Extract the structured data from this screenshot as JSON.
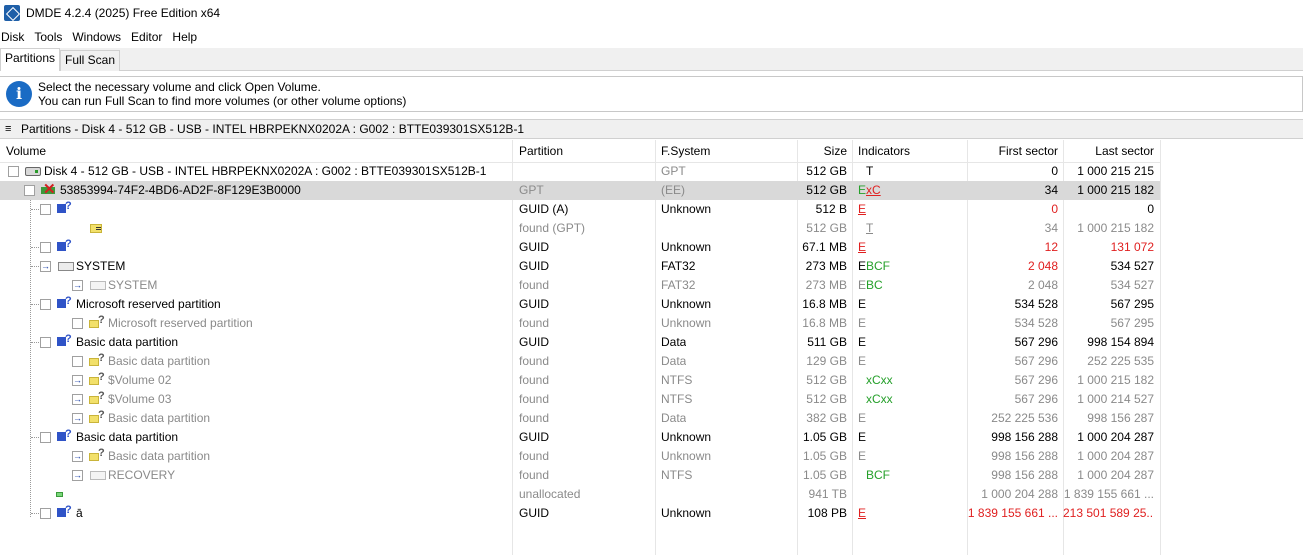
{
  "window": {
    "title": "DMDE 4.2.4 (2025) Free Edition x64",
    "icon": "dmde-app-icon"
  },
  "menu": [
    "Disk",
    "Tools",
    "Windows",
    "Editor",
    "Help"
  ],
  "tabs": [
    {
      "label": "Partitions",
      "active": true
    },
    {
      "label": "Full Scan",
      "active": false
    }
  ],
  "info": {
    "icon": "info-icon",
    "line1": "Select the necessary volume and click Open Volume.",
    "line2": "You can run Full Scan to find more volumes (or other volume options)"
  },
  "panel": {
    "title": "Partitions - Disk 4 - 512 GB - USB - INTEL HBRPEKNX0202A : G002 : BTTE039301SX512B-1"
  },
  "columns": {
    "volume": "Volume",
    "partition": "Partition",
    "fsystem": "F.System",
    "size": "Size",
    "indicators": "Indicators",
    "first_sector": "First sector",
    "last_sector": "Last sector"
  },
  "rows": [
    {
      "volume": "Disk 4 - 512 GB - USB - INTEL HBRPEKNX0202A : G002 : BTTE039301SX512B-1",
      "partition": "",
      "fs": "GPT",
      "size": "512 GB",
      "ind": "T",
      "first": "0",
      "last": "1 000 215 215"
    },
    {
      "volume": "53853994-74F2-4BD6-AD2F-8F129E3B0000",
      "partition": "GPT",
      "fs": "(EE)",
      "size": "512 GB",
      "ind_e": "E",
      "ind_x": "x",
      "ind_c": "C",
      "first": "34",
      "last": "1 000 215 182"
    },
    {
      "volume": "?",
      "partition": "GUID (A)",
      "fs": "Unknown",
      "size": "512 B",
      "ind": "E",
      "first": "0",
      "last": "0"
    },
    {
      "volume": "",
      "partition": "found (GPT)",
      "fs": "",
      "size": "512 GB",
      "ind": "T",
      "first": "34",
      "last": "1 000 215 182"
    },
    {
      "volume": "?",
      "partition": "GUID",
      "fs": "Unknown",
      "size": "67.1 MB",
      "ind": "E",
      "first": "12",
      "last": "131 072"
    },
    {
      "volume": "SYSTEM",
      "partition": "GUID",
      "fs": "FAT32",
      "size": "273 MB",
      "ind_e": "E",
      "ind_rest": "BCF",
      "first": "2 048",
      "last": "534 527"
    },
    {
      "volume": "SYSTEM",
      "partition": "found",
      "fs": "FAT32",
      "size": "273 MB",
      "ind_e": "E",
      "ind_rest": "BC",
      "first": "2 048",
      "last": "534 527"
    },
    {
      "volume": "Microsoft reserved partition",
      "partition": "GUID",
      "fs": "Unknown",
      "size": "16.8 MB",
      "ind": "E",
      "first": "534 528",
      "last": "567 295"
    },
    {
      "volume": "Microsoft reserved partition",
      "partition": "found",
      "fs": "Unknown",
      "size": "16.8 MB",
      "ind": "E",
      "first": "534 528",
      "last": "567 295"
    },
    {
      "volume": "Basic data partition",
      "partition": "GUID",
      "fs": "Data",
      "size": "511 GB",
      "ind": "E",
      "first": "567 296",
      "last": "998 154 894"
    },
    {
      "volume": "Basic data partition",
      "partition": "found",
      "fs": "Data",
      "size": "129 GB",
      "ind": "E",
      "first": "567 296",
      "last": "252 225 535"
    },
    {
      "volume": "$Volume 02",
      "partition": "found",
      "fs": "NTFS",
      "size": "512 GB",
      "ind": "xCxx",
      "first": "567 296",
      "last": "1 000 215 182"
    },
    {
      "volume": "$Volume 03",
      "partition": "found",
      "fs": "NTFS",
      "size": "512 GB",
      "ind": "xCxx",
      "first": "567 296",
      "last": "1 000 214 527"
    },
    {
      "volume": "Basic data partition",
      "partition": "found",
      "fs": "Data",
      "size": "382 GB",
      "ind": "E",
      "first": "252 225 536",
      "last": "998 156 287"
    },
    {
      "volume": "Basic data partition",
      "partition": "GUID",
      "fs": "Unknown",
      "size": "1.05 GB",
      "ind": "E",
      "first": "998 156 288",
      "last": "1 000 204 287"
    },
    {
      "volume": "Basic data partition",
      "partition": "found",
      "fs": "Unknown",
      "size": "1.05 GB",
      "ind": "E",
      "first": "998 156 288",
      "last": "1 000 204 287"
    },
    {
      "volume": "RECOVERY",
      "partition": "found",
      "fs": "NTFS",
      "size": "1.05 GB",
      "ind": "BCF",
      "first": "998 156 288",
      "last": "1 000 204 287"
    },
    {
      "volume": "",
      "partition": "unallocated",
      "fs": "",
      "size": "941 TB",
      "ind": "",
      "first": "1 000 204 288",
      "last": "1 839 155 661 ..."
    },
    {
      "volume": "ā",
      "partition": "GUID",
      "fs": "Unknown",
      "size": "108 PB",
      "ind": "E",
      "first": "1 839 155 661 ...",
      "last": "213 501 589 25..."
    }
  ]
}
